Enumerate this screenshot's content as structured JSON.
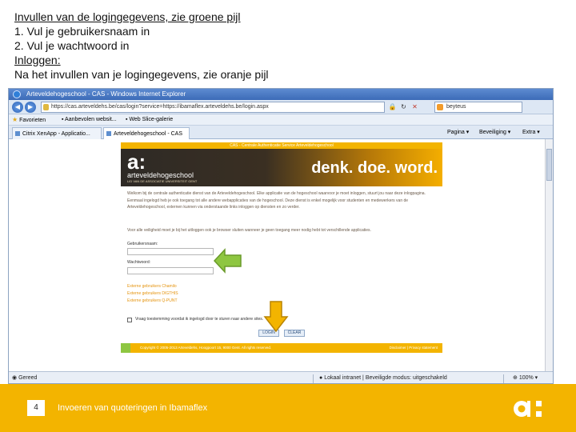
{
  "slide": {
    "instructions": {
      "line1": "Invullen van de logingegevens, zie groene pijl",
      "line2": "1. Vul je gebruikersnaam in",
      "line3": "2. Vul je wachtwoord in",
      "line4": "Inloggen:",
      "line5": "Na het invullen van je logingegevens, zie oranje pijl"
    },
    "footer": {
      "page_number": "4",
      "title": "Invoeren van quoteringen in Ibamaflex",
      "logo": "a:"
    },
    "colors": {
      "brand_yellow": "#f3b400",
      "green_arrow": "#8ec641",
      "orange_arrow": "#f3b400"
    }
  },
  "browser": {
    "window_title": "Arteveldehogeschool - CAS - Windows Internet Explorer",
    "address": "https://cas.arteveldehs.be/cas/login?service=https://ibamaflex.arteveldehs.be/login.aspx",
    "search_text": "beyteus",
    "favorites_label": "Favorieten",
    "fav_items": [
      "Aanbevolen websit...",
      "Web Slice-galerie"
    ],
    "tabs": [
      "Citrix XenApp - Applicatio...",
      "Arteveldehogeschool - CAS"
    ],
    "commands": [
      "Pagina",
      "Beveiliging",
      "Extra"
    ],
    "status": {
      "left": "Gereed",
      "zone": "Lokaal intranet | Beveiligde modus: uitgeschakeld",
      "zoom": "100%"
    }
  },
  "cas_page": {
    "topbar": "CAS - Centrale Authenticatie Service Arteveldehogeschool",
    "logo_mark": "a:",
    "logo_name": "arteveldehogeschool",
    "logo_subtitle": "LID VAN DE ASSOCIATIE UNIVERSITEIT GENT",
    "slogan": "denk. doe. word.",
    "intro": "Welkom bij de centrale authenticatie dienst van de Arteveldehogeschool. Elke applicatie van de hogeschool waarvoor je moet inloggen, stuurt jou naar deze inlogpagina. Eenmaal ingelogd heb je ook toegang tot alle andere webapplicaties van de hogeschool. Deze dienst is enkel mogelijk voor studenten en medewerkers van de Arteveldehogeschool, externen kunnen via onderstaande links inloggen op diensten en zo verder.",
    "warning": "Voor alle veiligheid moet je bij het uitloggen ook je browser sluiten wanneer je geen toegang meer nodig hebt tot verschillende applicaties.",
    "username_label": "Gebruikersnaam:",
    "password_label": "Wachtwoord:",
    "external_links": [
      "Externe gebruikers Chamilo",
      "Externe gebruikers DIGTHIS",
      "Externe gebruikers Q-PUNT"
    ],
    "remember_label": "Vraag toestemming voordat ik ingelogd door te sturen naar andere sites.",
    "login_button": "LOGIN",
    "clear_button": "CLEAR",
    "footer_copy": "Copyright © 2005-2013 Arteveldehs, Hoogpoort 15, 9000 Gent. All rights reserved.",
    "footer_disclaimer": "Disclaimer | Privacy statement"
  }
}
